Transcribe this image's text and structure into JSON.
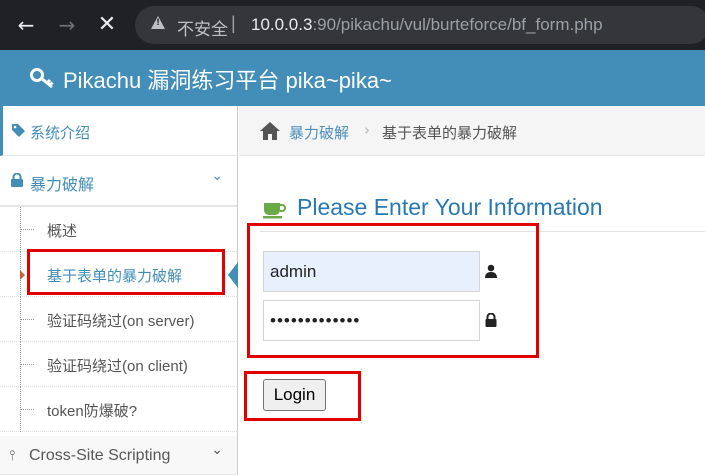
{
  "browser": {
    "back_icon": "←",
    "forward_icon": "→",
    "stop_icon": "✕",
    "insecure_label": "不安全",
    "separator": "|",
    "url_host": "10.0.0.3",
    "url_rest": ":90/pikachu/vul/burteforce/bf_form.php"
  },
  "header": {
    "title": "Pikachu 漏洞练习平台 pika~pika~"
  },
  "sidebar": {
    "top_item": "系统介绍",
    "open_section": "暴力破解",
    "sub_items": [
      {
        "label": "概述"
      },
      {
        "label": "基于表单的暴力破解"
      },
      {
        "label": "验证码绕过(on server)"
      },
      {
        "label": "验证码绕过(on client)"
      },
      {
        "label": "token防爆破?"
      }
    ],
    "next_section": "Cross-Site Scripting",
    "chevron": "⌄"
  },
  "breadcrumb": {
    "parent": "暴力破解",
    "separator": "›",
    "current": "基于表单的暴力破解"
  },
  "form": {
    "title": "Please Enter Your Information",
    "username_value": "admin",
    "password_value": "•••••••••••••",
    "login_label": "Login"
  },
  "colors": {
    "header_bg": "#438eb9",
    "accent": "#2679b5",
    "annotation_red": "#e00000"
  }
}
